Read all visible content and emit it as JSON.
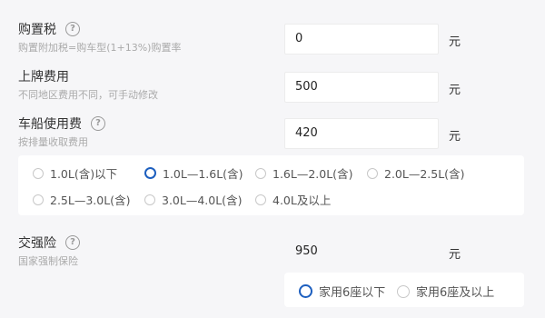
{
  "purchase_tax": {
    "label": "购置税",
    "sub": "购置附加税=购车型(1+13%)购置率",
    "value": "0",
    "unit": "元"
  },
  "plate_fee": {
    "label": "上牌费用",
    "sub": "不同地区费用不同，可手动修改",
    "value": "500",
    "unit": "元"
  },
  "vehicle_tax": {
    "label": "车船使用费",
    "sub": "按排量收取费用",
    "value": "420",
    "unit": "元",
    "options": [
      {
        "label": "1.0L(含)以下",
        "selected": false
      },
      {
        "label": "1.0L—1.6L(含)",
        "selected": true
      },
      {
        "label": "1.6L—2.0L(含)",
        "selected": false
      },
      {
        "label": "2.0L—2.5L(含)",
        "selected": false
      },
      {
        "label": "2.5L—3.0L(含)",
        "selected": false
      },
      {
        "label": "3.0L—4.0L(含)",
        "selected": false
      },
      {
        "label": "4.0L及以上",
        "selected": false
      }
    ]
  },
  "compulsory_insurance": {
    "label": "交强险",
    "sub": "国家强制保险",
    "value": "950",
    "unit": "元",
    "options": [
      {
        "label": "家用6座以下",
        "selected": true
      },
      {
        "label": "家用6座及以上",
        "selected": false
      }
    ]
  },
  "icons": {
    "help": "question-circle-icon",
    "radio": "radio-icon"
  },
  "colors": {
    "accent": "#1d5fbf",
    "background": "#f6f6f8"
  }
}
